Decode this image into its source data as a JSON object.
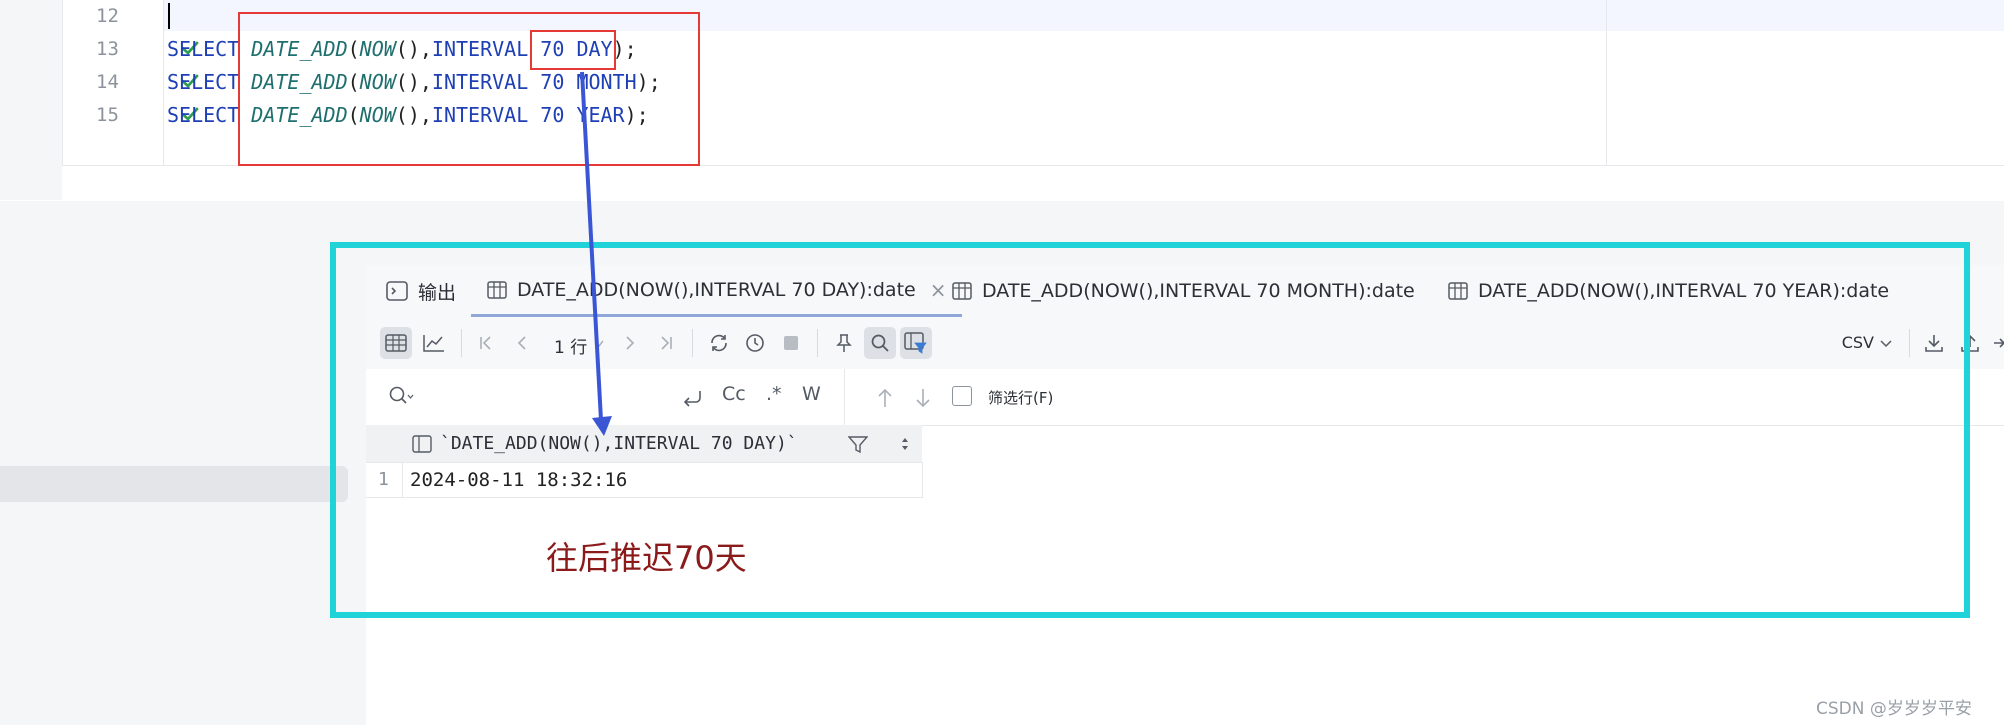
{
  "editor": {
    "lines": [
      {
        "num": "12",
        "code": "",
        "status": ""
      },
      {
        "num": "13",
        "status": "ok",
        "keyword": "SELECT",
        "func": "DATE_ADD",
        "inner": "NOW",
        "interval_kw": "INTERVAL",
        "amount": "70",
        "unit": "DAY"
      },
      {
        "num": "14",
        "status": "ok",
        "keyword": "SELECT",
        "func": "DATE_ADD",
        "inner": "NOW",
        "interval_kw": "INTERVAL",
        "amount": "70",
        "unit": "MONTH"
      },
      {
        "num": "15",
        "status": "ok",
        "keyword": "SELECT",
        "func": "DATE_ADD",
        "inner": "NOW",
        "interval_kw": "INTERVAL",
        "amount": "70",
        "unit": "YEAR"
      }
    ]
  },
  "results": {
    "tabs": [
      {
        "label": "输出",
        "icon": "terminal-icon",
        "active": false
      },
      {
        "label": "DATE_ADD(NOW(),INTERVAL 70 DAY):date",
        "icon": "table-icon",
        "active": true,
        "closable": true
      },
      {
        "label": "DATE_ADD(NOW(),INTERVAL 70 MONTH):date",
        "icon": "table-icon",
        "active": false
      },
      {
        "label": "DATE_ADD(NOW(),INTERVAL 70 YEAR):date",
        "icon": "table-icon",
        "active": false
      }
    ],
    "close_glyph": "×",
    "toolbar": {
      "rows_label": "1 行",
      "export_format": "CSV"
    },
    "search": {
      "case_label": "Cc",
      "regex_label": ".*",
      "word_label": "W",
      "filter_rows_label": "筛选行(F)"
    },
    "grid": {
      "column_header": "`DATE_ADD(NOW(),INTERVAL 70 DAY)`",
      "rows": [
        {
          "num": "1",
          "value": "2024-08-11 18:32:16"
        }
      ]
    }
  },
  "annotation": {
    "note": "往后推迟70天"
  },
  "watermark": "CSDN @岁岁岁平安",
  "colors": {
    "keyword": "#1f3fb5",
    "function": "#1f6f6f",
    "annotation_red": "#e53935",
    "annotation_cyan": "#1fd3d8",
    "arrow_blue": "#3a56d4",
    "note_text": "#8b1a1a"
  }
}
